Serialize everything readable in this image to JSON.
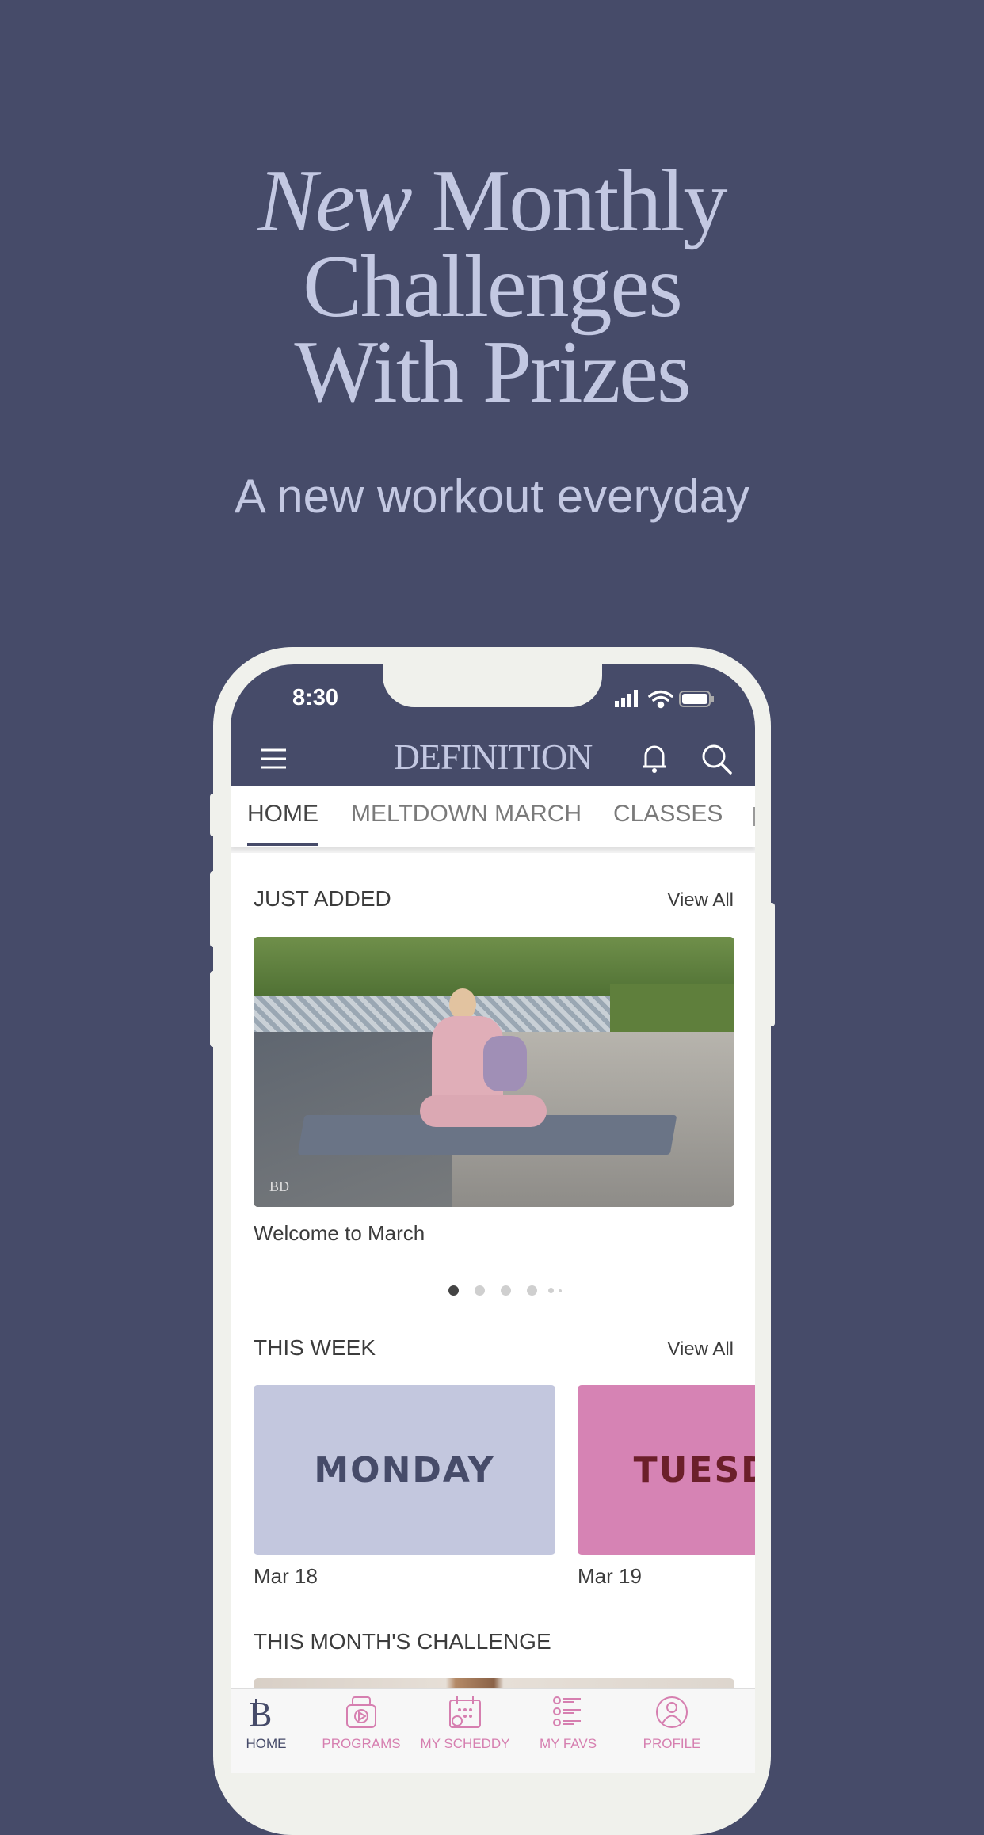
{
  "headline": {
    "line1_italic": "New",
    "line1_rest": "Monthly",
    "line2": "Challenges",
    "line3": "With Prizes"
  },
  "subtitle": "A new workout everyday",
  "status": {
    "time": "8:30"
  },
  "app": {
    "logo": "DEFINITION",
    "icons": [
      "menu-icon",
      "bell-icon",
      "search-icon"
    ]
  },
  "tabs": [
    {
      "label": "HOME",
      "active": true
    },
    {
      "label": "MELTDOWN MARCH"
    },
    {
      "label": "CLASSES"
    }
  ],
  "just_added": {
    "title": "JUST ADDED",
    "view_all": "View All",
    "item_title": "Welcome to March",
    "watermark": "BD",
    "dots": 5,
    "active_dot": 0
  },
  "this_week": {
    "title": "THIS WEEK",
    "view_all": "View All",
    "days": [
      {
        "label": "MONDAY",
        "date": "Mar 18",
        "bg": "#c3c7de",
        "fg": "#464b69"
      },
      {
        "label": "TUESDAY",
        "date": "Mar 19",
        "bg": "#d683b4",
        "fg": "#6b1f2a"
      }
    ]
  },
  "challenge": {
    "title": "THIS MONTH'S CHALLENGE"
  },
  "bottom_nav": [
    {
      "label": "HOME",
      "active": true
    },
    {
      "label": "PROGRAMS"
    },
    {
      "label": "MY SCHEDDY"
    },
    {
      "label": "MY FAVS"
    },
    {
      "label": "PROFILE"
    }
  ],
  "colors": {
    "bg": "#464b69",
    "accent": "#c3c8e2",
    "pink": "#d67fb0"
  }
}
